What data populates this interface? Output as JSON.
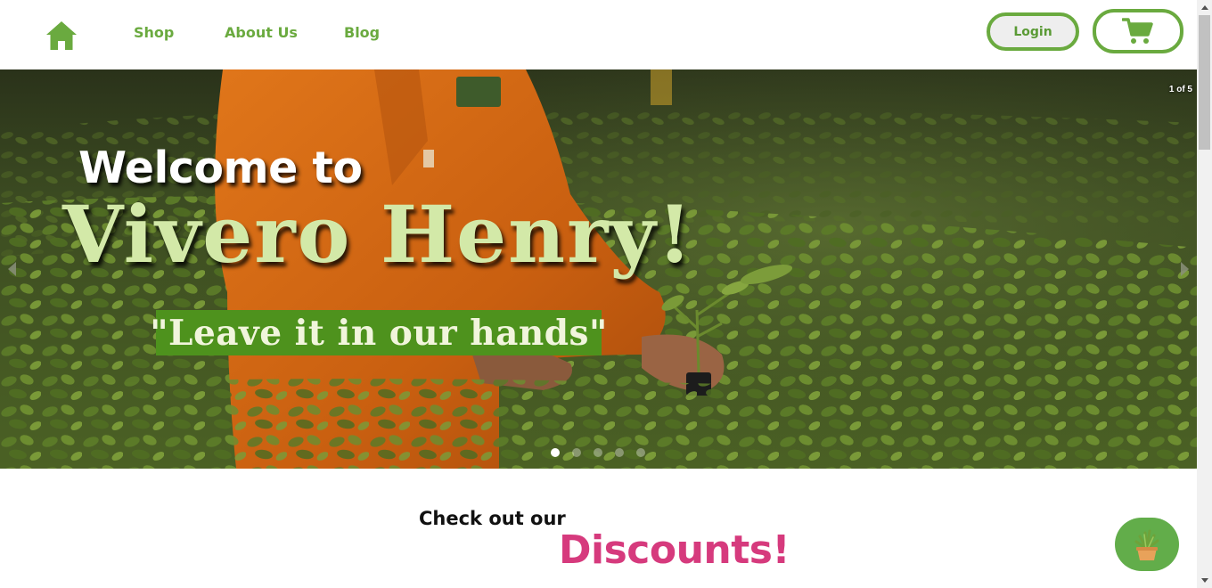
{
  "header": {
    "home_icon": "home-icon",
    "nav": {
      "shop": "Shop",
      "about": "About Us",
      "blog": "Blog"
    },
    "login_label": "Login",
    "cart_icon": "shopping-cart-icon"
  },
  "hero": {
    "counter": "1 of 5",
    "welcome": "Welcome to",
    "title": "Vivero Henry!",
    "slogan": "\"Leave it in our hands\"",
    "current_slide": 1,
    "total_slides": 5,
    "prev_icon": "chevron-left-icon",
    "next_icon": "chevron-right-icon"
  },
  "promo": {
    "lead": "Check out our",
    "highlight": "Discounts!"
  },
  "chat": {
    "icon": "potted-plant-icon"
  },
  "colors": {
    "brand_green": "#6aaa3f",
    "slogan_green": "#4e921d",
    "title_light_green": "#d3e9a8",
    "discount_pink": "#d63a7d",
    "chat_green": "#62ad4a"
  }
}
